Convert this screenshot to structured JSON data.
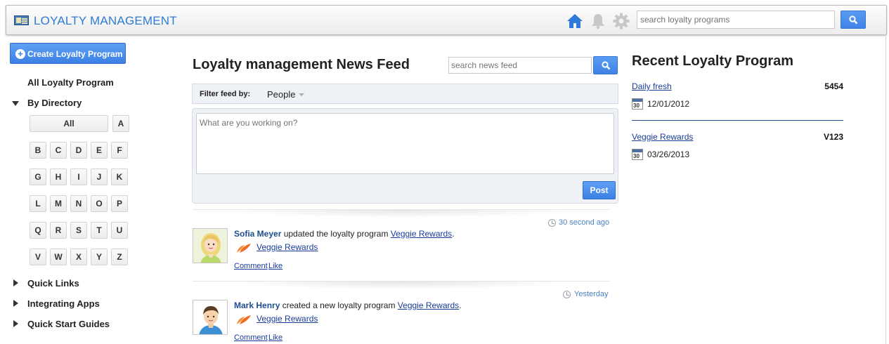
{
  "header": {
    "app_title": "LOYALTY MANAGEMENT",
    "search_placeholder": "search loyalty programs",
    "icons": [
      "home-icon",
      "bell-icon",
      "gear-icon",
      "search-icon"
    ],
    "accent_color": "#2d7cd4"
  },
  "sidebar": {
    "create_label": "Create Loyalty Program",
    "all_programs": "All Loyalty Program",
    "by_directory": "By Directory",
    "letters": [
      "All",
      "A",
      "B",
      "C",
      "D",
      "E",
      "F",
      "G",
      "H",
      "I",
      "J",
      "K",
      "L",
      "M",
      "N",
      "O",
      "P",
      "Q",
      "R",
      "S",
      "T",
      "U",
      "V",
      "W",
      "X",
      "Y",
      "Z"
    ],
    "quick_links": "Quick Links",
    "integrating_apps": "Integrating Apps",
    "quick_start": "Quick Start Guides"
  },
  "feed": {
    "title": "Loyalty management News Feed",
    "search_placeholder": "search news feed",
    "filter_label": "Filter feed by:",
    "filter_value": "People",
    "composer_placeholder": "What are you working on?",
    "post_label": "Post",
    "posts": [
      {
        "time": "30 second ago",
        "user": "Sofia Meyer",
        "action": " updated the loyalty program ",
        "target": "Veggie Rewards",
        "program": "Veggie Rewards",
        "comment": "Comment",
        "like": "Like"
      },
      {
        "time": "Yesterday",
        "user": "Mark Henry",
        "action": " created a new loyalty program ",
        "target": "Veggie Rewards",
        "program": "Veggie Rewards",
        "comment": "Comment",
        "like": "Like"
      }
    ]
  },
  "recent": {
    "title": "Recent Loyalty Program",
    "items": [
      {
        "name": "Daily fresh",
        "code": "5454",
        "date": "12/01/2012",
        "cal_day": "30"
      },
      {
        "name": "Veggie Rewards",
        "code": "V123",
        "date": "03/26/2013",
        "cal_day": "30"
      }
    ]
  }
}
